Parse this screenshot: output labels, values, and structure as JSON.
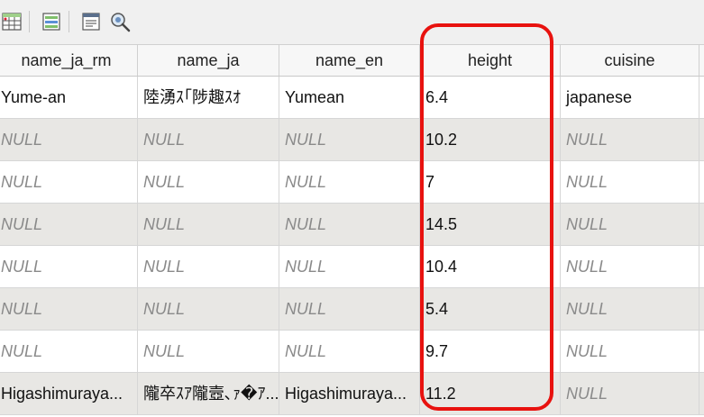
{
  "toolbar": {
    "buttons": [
      {
        "icon": "field-calculator-icon"
      },
      {
        "icon": "conditional-format-icon"
      },
      {
        "icon": "form-view-icon"
      },
      {
        "icon": "zoom-to-selection-icon"
      }
    ]
  },
  "table": {
    "columns": [
      "name_ja_rm",
      "name_ja",
      "name_en",
      "height",
      "cuisine"
    ],
    "rows": [
      [
        "Yume-an",
        "陸湧ｽ｢陟趣ｽｵ",
        "Yumean",
        "6.4",
        "japanese"
      ],
      [
        "NULL",
        "NULL",
        "NULL",
        "10.2",
        "NULL"
      ],
      [
        "NULL",
        "NULL",
        "NULL",
        "7",
        "NULL"
      ],
      [
        "NULL",
        "NULL",
        "NULL",
        "14.5",
        "NULL"
      ],
      [
        "NULL",
        "NULL",
        "NULL",
        "10.4",
        "NULL"
      ],
      [
        "NULL",
        "NULL",
        "NULL",
        "5.4",
        "NULL"
      ],
      [
        "NULL",
        "NULL",
        "NULL",
        "9.7",
        "NULL"
      ],
      [
        "Higashimuraya...",
        "隴卒ｽｱ隴壼､ｧ�ｱ...",
        "Higashimuraya...",
        "11.2",
        "NULL"
      ]
    ]
  },
  "colors": {
    "highlight": "#e8120f",
    "alt_row": "#e8e7e4",
    "null_text": "#8a8a8a"
  }
}
